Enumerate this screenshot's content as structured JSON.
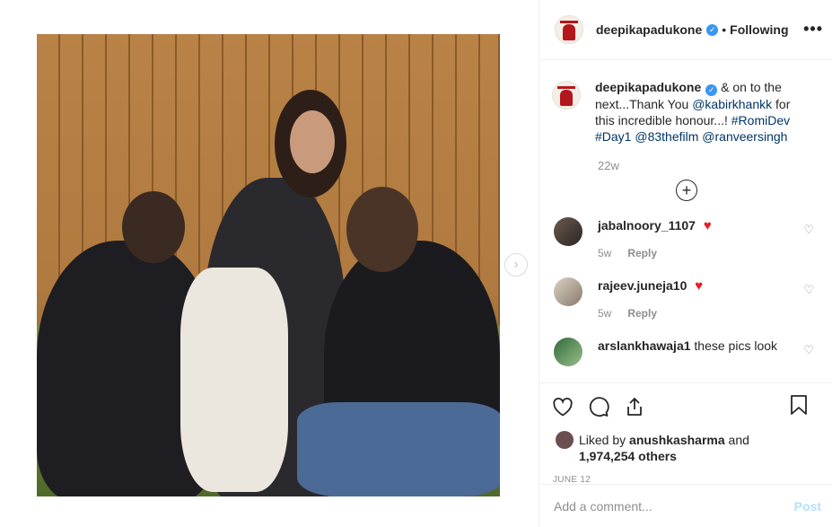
{
  "header": {
    "username": "deepikapadukone",
    "verified_glyph": "✓",
    "separator": "•",
    "follow_status": "Following",
    "more_glyph": "•••"
  },
  "caption": {
    "username": "deepikapadukone",
    "verified_glyph": "✓",
    "text_1": " & on to the next...Thank You ",
    "mention_1": "@kabirkhankk",
    "text_2": " for this incredible honour...! ",
    "hashtag_1": "#RomiDev",
    "hashtag_2": "#Day1",
    "mention_2": "@83thefilm",
    "mention_3": "@ranveersingh",
    "timestamp": "22w",
    "load_more_glyph": "+"
  },
  "comments": [
    {
      "username": "jabalnoory_1107",
      "text": "",
      "emoji": "♥",
      "age": "5w",
      "reply": "Reply"
    },
    {
      "username": "rajeev.juneja10",
      "text": "",
      "emoji": "♥",
      "age": "5w",
      "reply": "Reply"
    },
    {
      "username": "arslankhawaja1",
      "text": "these pics look",
      "emoji": "",
      "age": "",
      "reply": ""
    }
  ],
  "actions": {
    "like_icon": "heart-outline-icon",
    "comment_icon": "comment-icon",
    "share_icon": "share-icon",
    "save_icon": "bookmark-icon",
    "liked_by_prefix": "Liked by ",
    "liked_by_user": "anushkasharma",
    "liked_by_and": " and",
    "others_count": "1,974,254 others",
    "date": "JUNE 12"
  },
  "comment_box": {
    "placeholder": "Add a comment...",
    "post_label": "Post"
  },
  "media": {
    "next_glyph": "›"
  },
  "colors": {
    "link": "#003569",
    "verified": "#3897f0",
    "heart": "#ed1c24",
    "post_disabled": "#b2dffc",
    "muted": "#8e8e8e"
  }
}
